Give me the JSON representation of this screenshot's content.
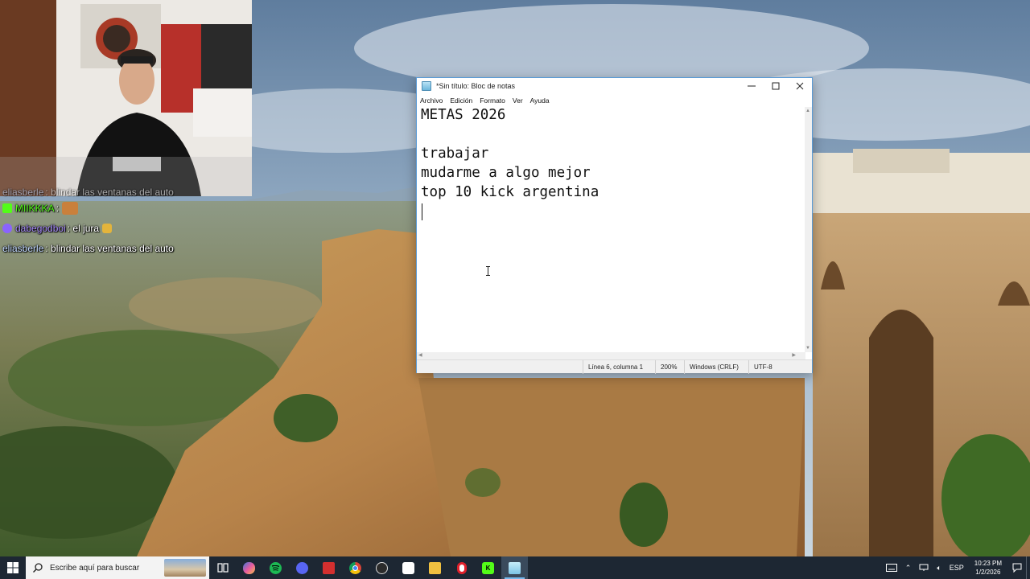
{
  "notepad": {
    "title": "*Sin título: Bloc de notas",
    "menu": [
      "Archivo",
      "Edición",
      "Formato",
      "Ver",
      "Ayuda"
    ],
    "lines": [
      "METAS 2026",
      "",
      "trabajar",
      "mudarme a algo mejor",
      "top 10 kick argentina"
    ],
    "status": {
      "position": "Línea 6, columna 1",
      "zoom": "200%",
      "line_endings": "Windows (CRLF)",
      "encoding": "UTF-8"
    },
    "icons": {
      "minimize": "minimize-icon",
      "maximize": "maximize-icon",
      "close": "close-icon"
    }
  },
  "chat": {
    "messages": [
      {
        "user": "eliasberle",
        "text": "blindar las ventanas del auto",
        "user_color": "#c2d8ff",
        "badge_color": "",
        "faded": true
      },
      {
        "user": "MIIKKKA",
        "text": "",
        "user_color": "#53fc18",
        "badge_color": "#53fc18",
        "emote": true
      },
      {
        "user": "dabegodboi",
        "text": "el jura",
        "user_color": "#a78bfa",
        "badge_color": "#8a63ff",
        "emote_small": true
      },
      {
        "user": "eliasberle",
        "text": "blindar las ventanas del auto",
        "user_color": "#c2d8ff",
        "badge_color": ""
      }
    ]
  },
  "taskbar": {
    "search_placeholder": "Escribe aquí para buscar",
    "apps": [
      {
        "name": "task-view-icon",
        "color": "#1d2733",
        "glyph": "▥"
      },
      {
        "name": "copilot-icon",
        "color": "#3a78d8",
        "glyph": ""
      },
      {
        "name": "spotify-icon",
        "color": "#1db954",
        "glyph": ""
      },
      {
        "name": "discord-icon",
        "color": "#5865f2",
        "glyph": ""
      },
      {
        "name": "stream-app-icon",
        "color": "#d32f2f",
        "glyph": ""
      },
      {
        "name": "chrome-icon",
        "color": "#2e9e4f",
        "glyph": ""
      },
      {
        "name": "obs-icon",
        "color": "#303030",
        "glyph": ""
      },
      {
        "name": "capcut-icon",
        "color": "#111111",
        "glyph": ""
      },
      {
        "name": "file-explorer-icon",
        "color": "#f0c040",
        "glyph": ""
      },
      {
        "name": "opera-icon",
        "color": "#e0202b",
        "glyph": ""
      },
      {
        "name": "kick-icon",
        "color": "#53fc18",
        "glyph": "K"
      },
      {
        "name": "notepad-icon",
        "color": "#8fd0ee",
        "glyph": ""
      }
    ],
    "tray": {
      "language": "ESP",
      "time": "10:23 PM",
      "date": "1/2/2026"
    }
  }
}
